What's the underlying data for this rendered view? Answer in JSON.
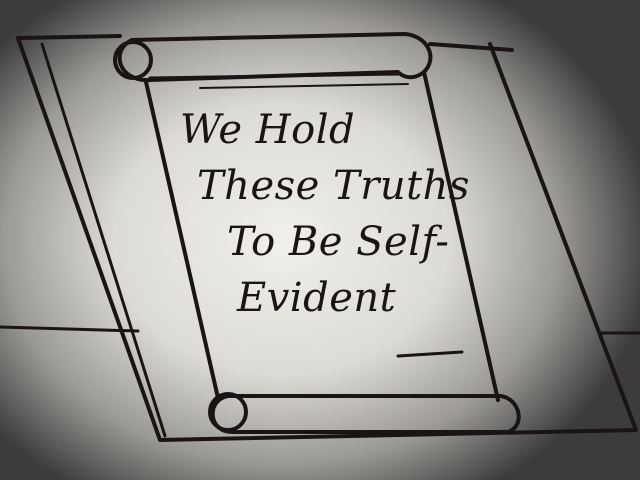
{
  "scroll": {
    "lines": [
      "We Hold",
      "These Truths",
      "To Be Self-",
      "Evident"
    ]
  },
  "colors": {
    "ink": "#1a1414",
    "paper": "#f0efeb",
    "vignette": "#3c3c3c"
  }
}
